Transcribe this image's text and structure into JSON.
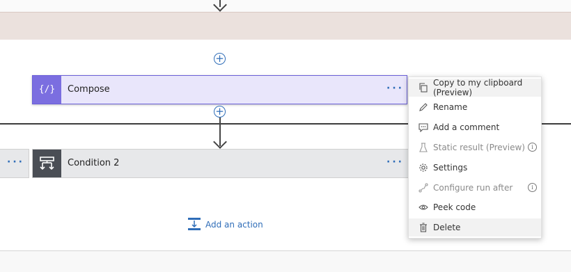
{
  "compose": {
    "title": "Compose",
    "icon": "compose-braces-icon",
    "more": "···"
  },
  "condition": {
    "title": "Condition 2",
    "icon": "condition-icon",
    "more": "···"
  },
  "left_card": {
    "more": "···"
  },
  "add_action": {
    "label": "Add an action"
  },
  "insert_step": {
    "symbol": "+"
  },
  "menu": {
    "items": [
      {
        "label": "Copy to my clipboard (Preview)",
        "icon": "copy-icon",
        "enabled": true,
        "info": ""
      },
      {
        "label": "Rename",
        "icon": "pencil-icon",
        "enabled": true,
        "info": ""
      },
      {
        "label": "Add a comment",
        "icon": "comment-icon",
        "enabled": true,
        "info": ""
      },
      {
        "label": "Static result (Preview)",
        "icon": "flask-icon",
        "enabled": false,
        "info": "i"
      },
      {
        "label": "Settings",
        "icon": "gear-icon",
        "enabled": true,
        "info": ""
      },
      {
        "label": "Configure run after",
        "icon": "run-after-icon",
        "enabled": false,
        "info": "i"
      },
      {
        "label": "Peek code",
        "icon": "eye-icon",
        "enabled": true,
        "info": ""
      },
      {
        "label": "Delete",
        "icon": "trash-icon",
        "enabled": true,
        "info": ""
      }
    ]
  },
  "colors": {
    "accent": "#2f6db8",
    "compose_icon_bg": "#7b6ee0",
    "compose_card_bg": "#e9e6fb",
    "condition_icon_bg": "#4a4e55",
    "top_band": "#ebe1dd"
  }
}
